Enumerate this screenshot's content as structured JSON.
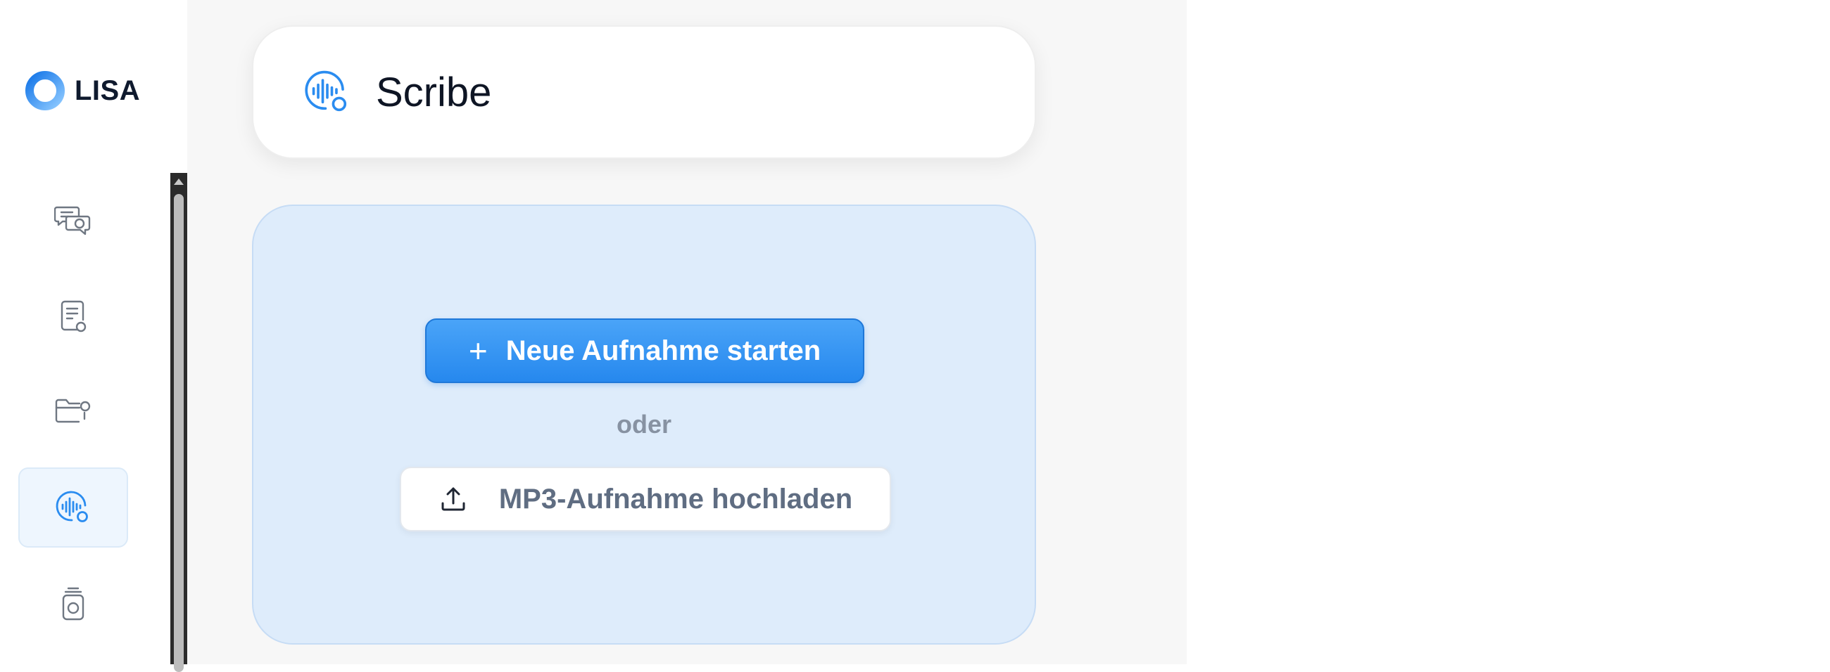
{
  "app": {
    "name": "LISA",
    "logo_icon": "ring-logo-icon",
    "accent_color": "#2a8cf0"
  },
  "sidebar": {
    "items": [
      {
        "id": "chat",
        "icon": "chat-bubbles-icon",
        "active": false
      },
      {
        "id": "documents",
        "icon": "document-settings-icon",
        "active": false
      },
      {
        "id": "folders",
        "icon": "folder-settings-icon",
        "active": false
      },
      {
        "id": "scribe",
        "icon": "audio-waveform-icon",
        "active": true
      },
      {
        "id": "assistant",
        "icon": "device-stack-icon",
        "active": false
      }
    ]
  },
  "header": {
    "title": "Scribe",
    "icon": "audio-waveform-icon"
  },
  "upload": {
    "start_label": "Neue Aufnahme starten",
    "start_icon": "plus-icon",
    "or_text": "oder",
    "upload_label": "MP3-Aufnahme hochladen",
    "upload_icon": "upload-icon"
  }
}
